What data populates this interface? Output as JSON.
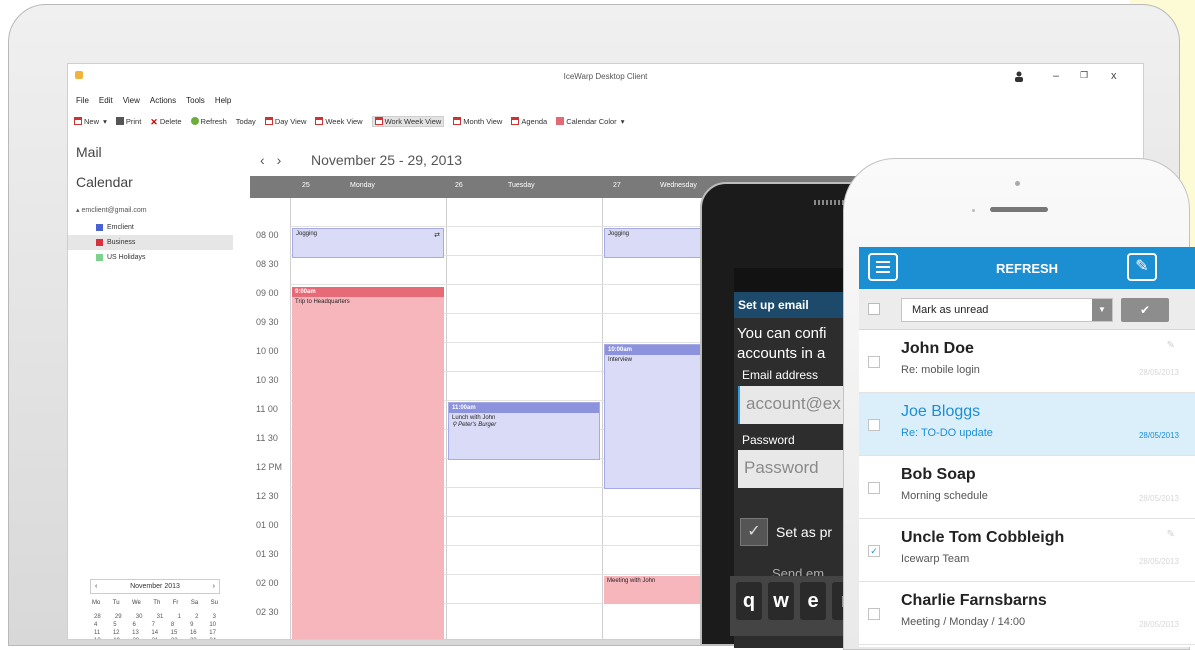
{
  "window": {
    "title": "IceWarp Desktop Client"
  },
  "menu": [
    "File",
    "Edit",
    "View",
    "Actions",
    "Tools",
    "Help"
  ],
  "toolbar": {
    "new": "New",
    "print": "Print",
    "delete": "Delete",
    "refresh": "Refresh",
    "today": "Today",
    "day_view": "Day View",
    "week_view": "Week View",
    "work_week_view": "Work Week View",
    "month_view": "Month View",
    "agenda": "Agenda",
    "calendar_color": "Calendar Color"
  },
  "sidebar": {
    "mail": "Mail",
    "calendar": "Calendar",
    "account": "emclient@gmail.com",
    "calendars": [
      {
        "label": "Emclient",
        "color": "#4a63d4"
      },
      {
        "label": "Business",
        "color": "#d8303c"
      },
      {
        "label": "US Holidays",
        "color": "#7cd390"
      }
    ]
  },
  "mini_calendar": {
    "month": "November 2013",
    "dows": [
      "Mo",
      "Tu",
      "We",
      "Th",
      "Fr",
      "Sa",
      "Su"
    ],
    "weeks": [
      [
        "28",
        "29",
        "30",
        "31",
        "1",
        "2",
        "3"
      ],
      [
        "4",
        "5",
        "6",
        "7",
        "8",
        "9",
        "10"
      ],
      [
        "11",
        "12",
        "13",
        "14",
        "15",
        "16",
        "17"
      ],
      [
        "18",
        "19",
        "20",
        "21",
        "22",
        "23",
        "24"
      ],
      [
        "25",
        "26",
        "27",
        "28",
        "29",
        "30",
        "1"
      ]
    ]
  },
  "calendar": {
    "range": "November 25 - 29, 2013",
    "days": [
      {
        "num": "25",
        "name": "Monday"
      },
      {
        "num": "26",
        "name": "Tuesday"
      },
      {
        "num": "27",
        "name": "Wednesday"
      }
    ],
    "times": [
      "08 00",
      "08 30",
      "09 00",
      "09 30",
      "10 00",
      "10 30",
      "11 00",
      "11 30",
      "12 PM",
      "12 30",
      "01 00",
      "01 30",
      "02 00",
      "02 30"
    ],
    "events": {
      "jog_mon": "Jogging",
      "jog_wed": "Jogging",
      "trip_time": "9:00am",
      "trip_title": "Trip to Headquarters",
      "interview_time": "10:00am",
      "interview_title": "Interview",
      "lunch_time": "11:00am",
      "lunch_title": "Lunch with John",
      "lunch_loc": "Peter's Burger",
      "meeting": "Meeting with John"
    }
  },
  "android": {
    "setup_title": "Set up email",
    "body_line1": "You can confi",
    "body_line2": "accounts in a",
    "email_label": "Email address",
    "email_placeholder": "account@ex",
    "password_label": "Password",
    "password_placeholder": "Password",
    "set_as": "Set as pr",
    "send": "Send em",
    "keys": [
      "q",
      "w",
      "e",
      "r"
    ]
  },
  "iphone": {
    "title": "REFRESH",
    "action": "Mark as unread",
    "emails": [
      {
        "name": "John Doe",
        "subject": "Re: mobile login",
        "date": "28/05/2013"
      },
      {
        "name": "Joe Bloggs",
        "subject": "Re: TO-DO update",
        "date": "28/05/2013"
      },
      {
        "name": "Bob Soap",
        "subject": "Morning schedule",
        "date": "28/05/2013"
      },
      {
        "name": "Uncle Tom Cobbleigh",
        "subject": "Icewarp Team",
        "date": "28/05/2013"
      },
      {
        "name": "Charlie Farnsbarns",
        "subject": "Meeting / Monday / 14:00",
        "date": "28/05/2013"
      }
    ]
  }
}
